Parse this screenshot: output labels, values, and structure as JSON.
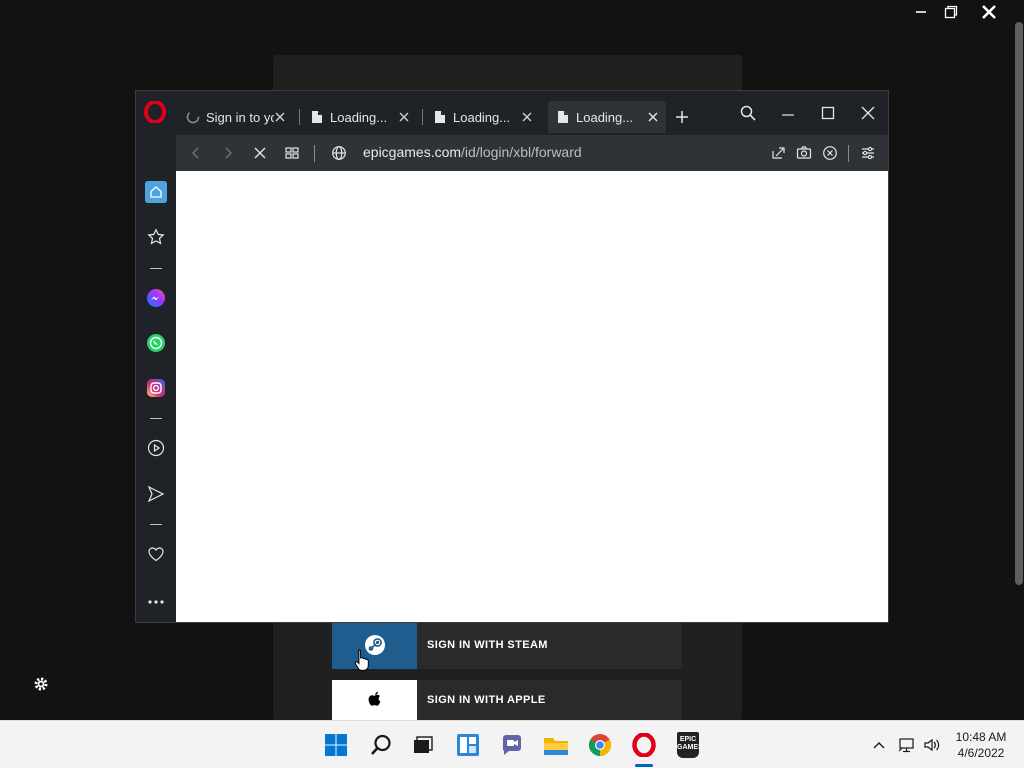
{
  "background_app": {
    "buttons": [
      {
        "name": "sign-in-steam",
        "label": "SIGN IN WITH STEAM",
        "icon": "steam-icon"
      },
      {
        "name": "sign-in-apple",
        "label": "SIGN IN WITH APPLE",
        "icon": "apple-icon"
      }
    ],
    "colors": {
      "steam_bg": "#1f5d8f",
      "apple_bg": "#ffffff"
    }
  },
  "browser": {
    "name": "Opera",
    "tabs": [
      {
        "title": "Sign in to yo",
        "icon": "loading-spinner-icon",
        "active": false
      },
      {
        "title": "Loading...",
        "icon": "page-icon",
        "active": false
      },
      {
        "title": "Loading...",
        "icon": "page-icon",
        "active": false
      },
      {
        "title": "Loading...",
        "icon": "page-icon",
        "active": true
      }
    ],
    "address": {
      "domain": "epicgames.com",
      "path": "/id/login/xbl/forward"
    },
    "sidebar": [
      "home-icon",
      "star-icon",
      "messenger-icon",
      "whatsapp-icon",
      "instagram-icon",
      "player-icon",
      "send-icon",
      "heart-icon",
      "more-icon"
    ],
    "colors": {
      "accent": "#e0001b",
      "frame": "#1f2226",
      "active_tab": "#2f3338"
    }
  },
  "taskbar": {
    "apps": [
      "start-icon",
      "search-icon",
      "task-view-icon",
      "widgets-icon",
      "teams-chat-icon",
      "file-explorer-icon",
      "chrome-icon",
      "opera-icon",
      "epic-games-icon"
    ],
    "clock": {
      "time": "10:48 AM",
      "date": "4/6/2022"
    },
    "epic_label": "EPIC\nGAMES"
  }
}
